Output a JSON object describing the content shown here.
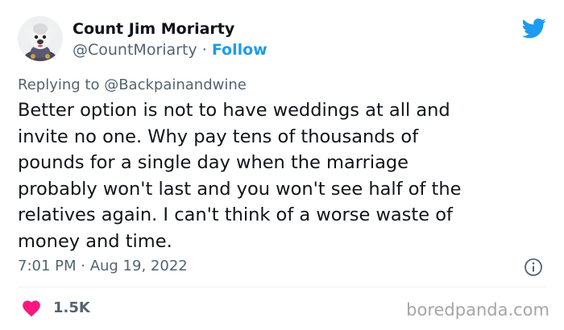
{
  "tweet": {
    "author_name": "Count Jim Moriarty",
    "handle": "@CountMoriarty",
    "separator": " · ",
    "follow_label": "Follow",
    "replying_prefix": "Replying to ",
    "replying_to": "@Backpainandwine",
    "body_lines": [
      "Better option is not to have weddings at all and",
      "invite no one. Why pay tens of thousands of",
      "pounds for a single day when the marriage",
      "probably won't last and you won't see half of the",
      "relatives again. I can't think of a worse waste of",
      "money and time."
    ],
    "timestamp": "7:01 PM · Aug 19, 2022",
    "like_count": "1.5K"
  },
  "watermark": "boredpanda.com",
  "icons": {
    "logo": "twitter-bird-icon",
    "info": "info-circle-icon",
    "like": "heart-icon"
  },
  "colors": {
    "accent": "#1d9bf0",
    "heart": "#f91880",
    "secondary_text": "#536471",
    "primary_text": "#0f1419"
  }
}
